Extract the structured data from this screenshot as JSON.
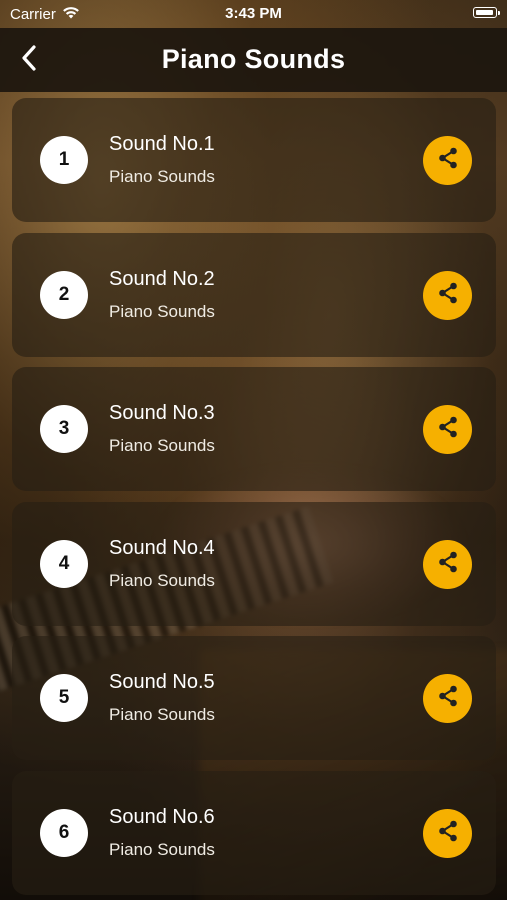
{
  "status_bar": {
    "carrier": "Carrier",
    "time": "3:43 PM",
    "icons": [
      "wifi-icon",
      "battery-icon"
    ]
  },
  "nav": {
    "title": "Piano Sounds",
    "back_icon": "chevron-left-icon"
  },
  "colors": {
    "accent": "#f6b000",
    "circle": "#ffffff",
    "text": "#ffffff"
  },
  "sounds": [
    {
      "number": "1",
      "title": "Sound No.1",
      "subtitle": "Piano Sounds"
    },
    {
      "number": "2",
      "title": "Sound No.2",
      "subtitle": "Piano Sounds"
    },
    {
      "number": "3",
      "title": "Sound No.3",
      "subtitle": "Piano Sounds"
    },
    {
      "number": "4",
      "title": "Sound No.4",
      "subtitle": "Piano Sounds"
    },
    {
      "number": "5",
      "title": "Sound No.5",
      "subtitle": "Piano Sounds"
    },
    {
      "number": "6",
      "title": "Sound No.6",
      "subtitle": "Piano Sounds"
    }
  ]
}
